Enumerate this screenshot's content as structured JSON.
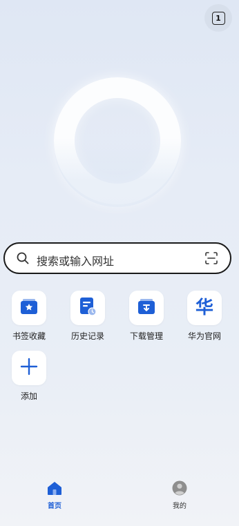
{
  "header": {
    "tab_count": "1"
  },
  "search": {
    "placeholder": "搜索或输入网址"
  },
  "shortcuts": [
    {
      "label": "书签收藏",
      "icon": "bookmark-star-icon"
    },
    {
      "label": "历史记录",
      "icon": "history-document-icon"
    },
    {
      "label": "下载管理",
      "icon": "download-box-icon"
    },
    {
      "label": "华为官网",
      "icon": "huawei-hua-icon",
      "glyph": "华"
    },
    {
      "label": "添加",
      "icon": "plus-icon"
    }
  ],
  "bottom_nav": [
    {
      "label": "首页",
      "icon": "home-icon",
      "active": true
    },
    {
      "label": "我的",
      "icon": "profile-avatar-icon",
      "active": false
    }
  ],
  "colors": {
    "accent": "#1e5fd6",
    "inactive": "#777777"
  }
}
